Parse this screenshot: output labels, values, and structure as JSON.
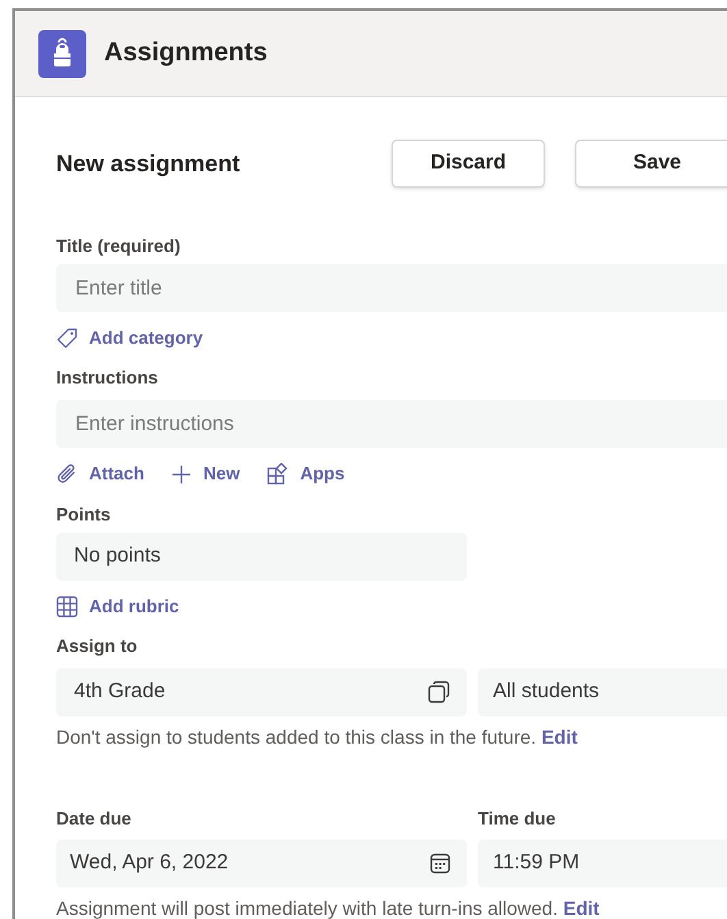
{
  "app": {
    "title": "Assignments"
  },
  "heading": "New assignment",
  "buttons": [
    {
      "label": "Discard"
    },
    {
      "label": "Save"
    }
  ],
  "title_field": {
    "label": "Title (required)",
    "placeholder": "Enter title"
  },
  "add_category": "Add category",
  "instructions": {
    "label": "Instructions",
    "placeholder": "Enter instructions"
  },
  "instruction_actions": [
    {
      "kind": "attach",
      "label": "Attach"
    },
    {
      "kind": "new",
      "label": "New"
    },
    {
      "kind": "apps",
      "label": "Apps"
    }
  ],
  "points": {
    "label": "Points",
    "value": "No points"
  },
  "add_rubric": "Add rubric",
  "assign_to": {
    "label": "Assign to",
    "class": "4th Grade",
    "students": "All students",
    "note": "Don't assign to students added to this class in the future.",
    "note_link": "Edit"
  },
  "due": {
    "date_label": "Date due",
    "date": "Wed, Apr 6, 2022",
    "time_label": "Time due",
    "time": "11:59 PM",
    "note": "Assignment will post immediately with late turn-ins allowed.",
    "note_link": "Edit"
  }
}
